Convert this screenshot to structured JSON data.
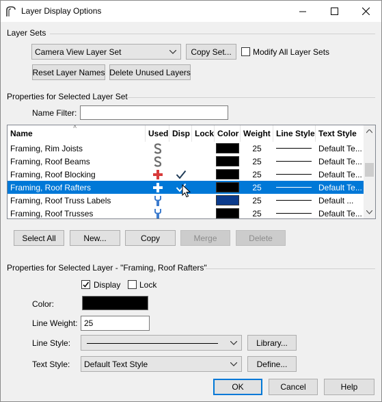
{
  "window": {
    "title": "Layer Display Options"
  },
  "layer_sets": {
    "label": "Layer Sets",
    "selected_set": "Camera View Layer Set",
    "copy_set_label": "Copy Set...",
    "modify_all_label": "Modify All Layer Sets",
    "modify_all_checked": false,
    "reset_names_label": "Reset Layer Names",
    "delete_unused_label": "Delete Unused Layers"
  },
  "properties_set": {
    "label": "Properties for Selected Layer Set",
    "name_filter_label": "Name Filter:",
    "name_filter_value": ""
  },
  "table": {
    "columns": [
      "Name",
      "Used",
      "Disp",
      "Lock",
      "Color",
      "Weight",
      "Line Style",
      "Text Style"
    ],
    "rows": [
      {
        "name": "Framing, Rim Joists",
        "used_icon": "s-icon",
        "disp": false,
        "lock": false,
        "color": "#000000",
        "weight": "25",
        "text_style": "Default Te...",
        "selected": false
      },
      {
        "name": "Framing, Roof Beams",
        "used_icon": "s-icon",
        "disp": false,
        "lock": false,
        "color": "#000000",
        "weight": "25",
        "text_style": "Default Te...",
        "selected": false
      },
      {
        "name": "Framing, Roof Blocking",
        "used_icon": "plus-icon",
        "disp": true,
        "lock": false,
        "color": "#000000",
        "weight": "25",
        "text_style": "Default Te...",
        "selected": false
      },
      {
        "name": "Framing, Roof Rafters",
        "used_icon": "plus-icon",
        "disp": true,
        "lock": false,
        "color": "#000000",
        "weight": "25",
        "text_style": "Default Te...",
        "selected": true
      },
      {
        "name": "Framing, Roof Truss Labels",
        "used_icon": "wrench-icon",
        "disp": false,
        "lock": false,
        "color": "#0b3b8c",
        "weight": "25",
        "text_style": "Default ...",
        "selected": false
      },
      {
        "name": "Framing, Roof Trusses",
        "used_icon": "wrench-icon",
        "disp": false,
        "lock": false,
        "color": "#000000",
        "weight": "25",
        "text_style": "Default Te...",
        "selected": false
      }
    ]
  },
  "actions": {
    "select_all": "Select All",
    "new": "New...",
    "copy": "Copy",
    "merge": "Merge",
    "delete": "Delete"
  },
  "properties_layer": {
    "label": "Properties for Selected Layer - \"Framing, Roof Rafters\"",
    "display_label": "Display",
    "display_checked": true,
    "lock_label": "Lock",
    "lock_checked": false,
    "color_label": "Color:",
    "color_value": "#000000",
    "line_weight_label": "Line Weight:",
    "line_weight_value": "25",
    "line_style_label": "Line Style:",
    "library_label": "Library...",
    "text_style_label": "Text Style:",
    "text_style_value": "Default Text Style",
    "define_label": "Define..."
  },
  "footer": {
    "ok": "OK",
    "cancel": "Cancel",
    "help": "Help"
  },
  "colors": {
    "selection": "#0078d7",
    "accent": "#0078d7",
    "used_plus": "#d83b3b",
    "used_s": "#6d6d6d",
    "used_wrench": "#2a6fc9",
    "check": "#1f3b57"
  }
}
